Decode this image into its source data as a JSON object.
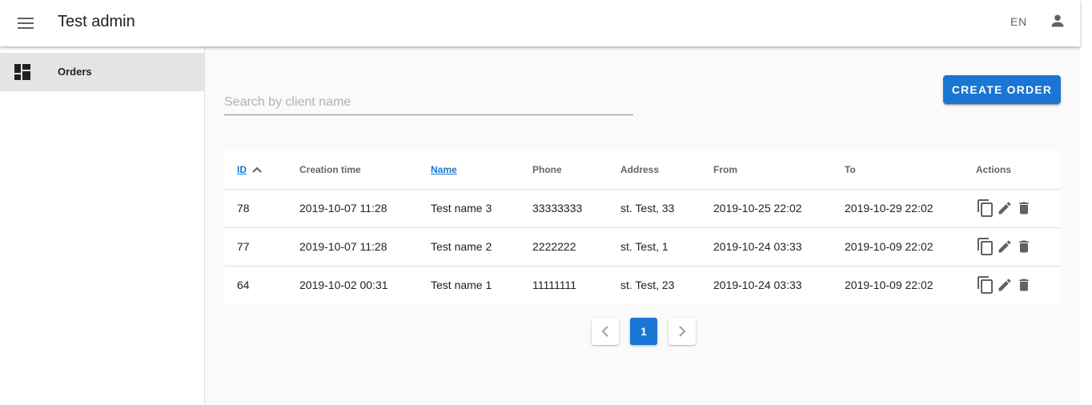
{
  "app": {
    "title": "Test admin",
    "language": "EN"
  },
  "sidebar": {
    "items": [
      {
        "label": "Orders",
        "icon": "dashboard-icon",
        "active": true
      }
    ]
  },
  "search": {
    "placeholder": "Search by client name",
    "value": ""
  },
  "toolbar": {
    "create_label": "CREATE ORDER"
  },
  "table": {
    "headers": {
      "id": "ID",
      "creation_time": "Creation time",
      "name": "Name",
      "phone": "Phone",
      "address": "Address",
      "from": "From",
      "to": "To",
      "actions": "Actions"
    },
    "sort": {
      "column": "ID",
      "direction": "ascending"
    },
    "rows": [
      {
        "id": "78",
        "creation_time": "2019-10-07 11:28",
        "name": "Test name 3",
        "phone": "33333333",
        "address": "st. Test, 33",
        "from": "2019-10-25 22:02",
        "to": "2019-10-29 22:02"
      },
      {
        "id": "77",
        "creation_time": "2019-10-07 11:28",
        "name": "Test name 2",
        "phone": "2222222",
        "address": "st. Test, 1",
        "from": "2019-10-24 03:33",
        "to": "2019-10-09 22:02"
      },
      {
        "id": "64",
        "creation_time": "2019-10-02 00:31",
        "name": "Test name 1",
        "phone": "11111111",
        "address": "st. Test, 23",
        "from": "2019-10-24 03:33",
        "to": "2019-10-09 22:02"
      }
    ],
    "row_actions": [
      "copy-icon",
      "edit-icon",
      "delete-icon"
    ]
  },
  "pagination": {
    "current_page": "1"
  },
  "colors": {
    "primary": "#1976d2",
    "sidebar_active": "#e4e4e4",
    "background": "#fafafa",
    "icon": "#616161"
  }
}
